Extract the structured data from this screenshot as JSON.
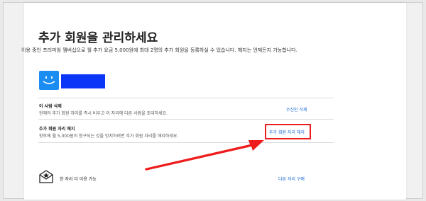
{
  "page": {
    "title": "추가 회원을 관리하세요",
    "subtitle": "이용 중인 프리미엄 멤버십으로 월 추가 요금 5,000원에 최대 2명의 추가 회원을 등록하실 수 있습니다. 해지는 언제든지 가능합니다."
  },
  "member": {
    "avatar_icon": "smiley-profile-icon",
    "avatar_color": "#1b8cf2",
    "name_redaction_color": "#0b36f7"
  },
  "remove_person": {
    "title": "이 사람 삭제",
    "description": "현재의 추가 회원 자리를 즉시 비우고 이 자리에 다른 사람을 초대하세요.",
    "action_label": "수신인 삭제"
  },
  "cancel_seat": {
    "title": "추가 회원 자리 해지",
    "description": "향후에 월 5,000원이 청구되는 것을 방지하려면 추가 회원 자리를 해지하세요.",
    "action_label": "추가 회원 자리 해지",
    "highlight_color": "#ee1c1c"
  },
  "footer": {
    "icon": "envelope-star-icon",
    "seat_text": "한 자리 더 이용 가능",
    "buy_label": "다른 자리 구매"
  },
  "colors": {
    "link": "#1b68d6",
    "arrow": "#ee1c1c"
  }
}
